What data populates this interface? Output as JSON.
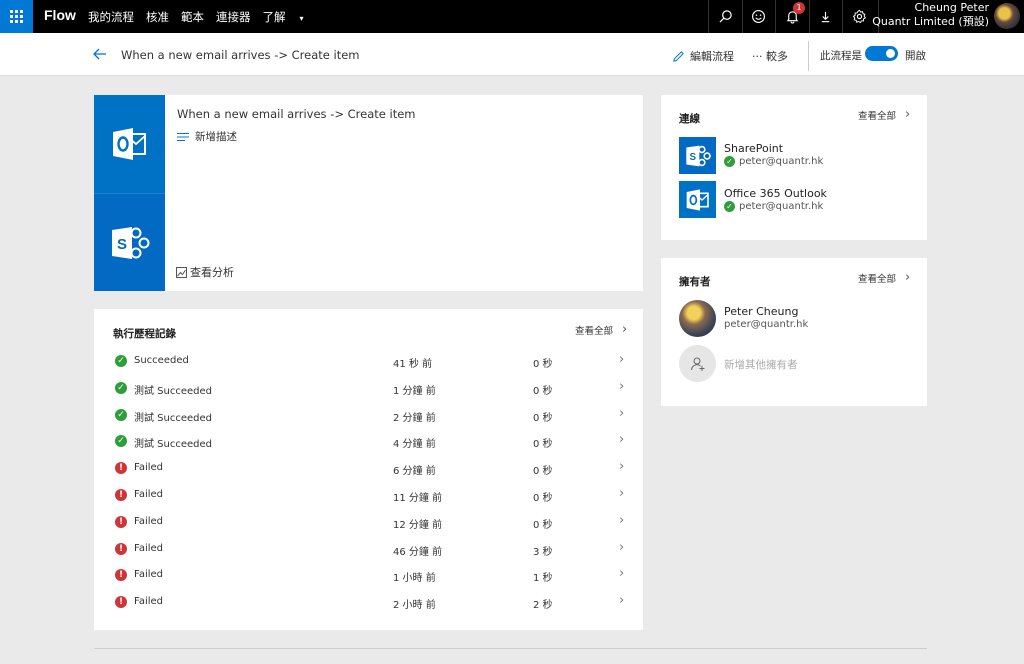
{
  "topbar": {
    "brand": "Flow",
    "nav": [
      "我的流程",
      "核准",
      "範本",
      "連接器"
    ],
    "nav_more": "了解",
    "notification_count": "1",
    "user_name": "Cheung Peter",
    "user_org": "Quantr Limited (預設)"
  },
  "subheader": {
    "flow_title": "When a new email arrives -> Create item",
    "edit_label": "編輯流程",
    "more_label": "··· 較多",
    "toggle_label": "此流程是",
    "toggle_state": "開啟"
  },
  "hero": {
    "title": "When a new email arrives -> Create item",
    "add_description": "新增描述",
    "analytics": "查看分析"
  },
  "runs": {
    "title": "執行歷程記錄",
    "see_all": "查看全部",
    "rows": [
      {
        "status": "ok",
        "label": "Succeeded",
        "ago": "41 秒 前",
        "duration": "0 秒"
      },
      {
        "status": "ok",
        "label": "測試 Succeeded",
        "ago": "1 分鐘 前",
        "duration": "0 秒"
      },
      {
        "status": "ok",
        "label": "測試 Succeeded",
        "ago": "2 分鐘 前",
        "duration": "0 秒"
      },
      {
        "status": "ok",
        "label": "測試 Succeeded",
        "ago": "4 分鐘 前",
        "duration": "0 秒"
      },
      {
        "status": "fail",
        "label": "Failed",
        "ago": "6 分鐘 前",
        "duration": "0 秒"
      },
      {
        "status": "fail",
        "label": "Failed",
        "ago": "11 分鐘 前",
        "duration": "0 秒"
      },
      {
        "status": "fail",
        "label": "Failed",
        "ago": "12 分鐘 前",
        "duration": "0 秒"
      },
      {
        "status": "fail",
        "label": "Failed",
        "ago": "46 分鐘 前",
        "duration": "3 秒"
      },
      {
        "status": "fail",
        "label": "Failed",
        "ago": "1 小時 前",
        "duration": "1 秒"
      },
      {
        "status": "fail",
        "label": "Failed",
        "ago": "2 小時 前",
        "duration": "2 秒"
      }
    ]
  },
  "connections": {
    "title": "連線",
    "see_all": "查看全部",
    "items": [
      {
        "name": "SharePoint",
        "account": "peter@quantr.hk"
      },
      {
        "name": "Office 365 Outlook",
        "account": "peter@quantr.hk"
      }
    ]
  },
  "owners": {
    "title": "擁有者",
    "see_all": "查看全部",
    "owner_name": "Peter Cheung",
    "owner_email": "peter@quantr.hk",
    "add_owner": "新增其他擁有者"
  },
  "colors": {
    "accent": "#0078d4",
    "success": "#2e9d3a",
    "failure": "#d13438",
    "outlook_tile": "#0072c6",
    "sharepoint_tile": "#036ac4"
  }
}
